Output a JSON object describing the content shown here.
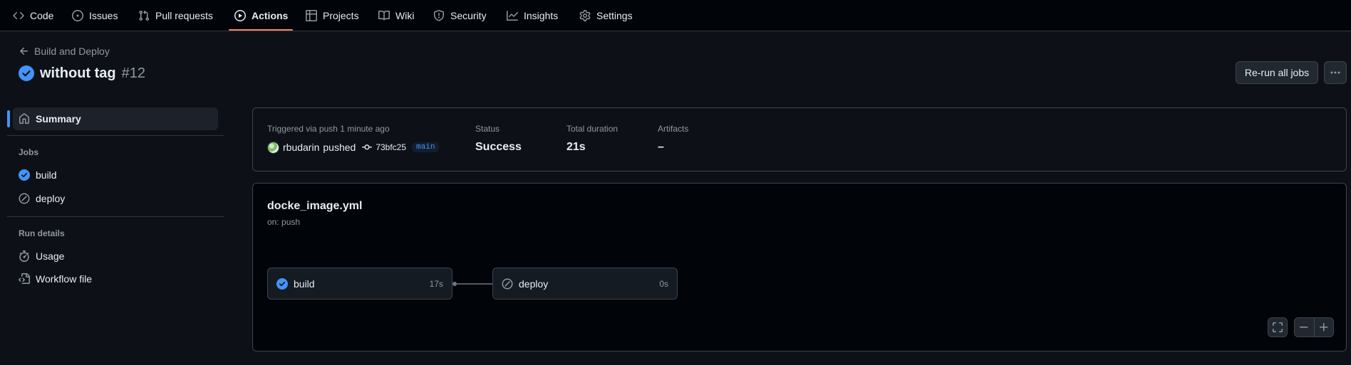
{
  "nav": {
    "items": [
      {
        "label": "Code",
        "icon": "code-icon"
      },
      {
        "label": "Issues",
        "icon": "issue-opened-icon"
      },
      {
        "label": "Pull requests",
        "icon": "git-pull-request-icon"
      },
      {
        "label": "Actions",
        "icon": "play-icon",
        "active": true
      },
      {
        "label": "Projects",
        "icon": "table-icon"
      },
      {
        "label": "Wiki",
        "icon": "book-icon"
      },
      {
        "label": "Security",
        "icon": "shield-icon"
      },
      {
        "label": "Insights",
        "icon": "graph-icon"
      },
      {
        "label": "Settings",
        "icon": "gear-icon"
      }
    ]
  },
  "header": {
    "back_label": "Build and Deploy",
    "title": "without tag",
    "run_number": "#12",
    "rerun_label": "Re-run all jobs",
    "more_label": "···"
  },
  "sidebar": {
    "summary_label": "Summary",
    "jobs_heading": "Jobs",
    "jobs": [
      {
        "label": "build",
        "status": "success"
      },
      {
        "label": "deploy",
        "status": "skipped"
      }
    ],
    "run_details_heading": "Run details",
    "run_details": [
      {
        "label": "Usage",
        "icon": "stopwatch-icon"
      },
      {
        "label": "Workflow file",
        "icon": "file-code-icon"
      }
    ]
  },
  "summary": {
    "trigger_label": "Triggered via push 1 minute ago",
    "actor": "rbudarin",
    "action": "pushed",
    "commit_sha": "73bfc25",
    "branch": "main",
    "status_label": "Status",
    "status_value": "Success",
    "duration_label": "Total duration",
    "duration_value": "21s",
    "artifacts_label": "Artifacts",
    "artifacts_value": "–"
  },
  "workflow": {
    "file_name": "docke_image.yml",
    "trigger": "on: push",
    "jobs": [
      {
        "name": "build",
        "duration": "17s",
        "status": "success"
      },
      {
        "name": "deploy",
        "duration": "0s",
        "status": "skipped"
      }
    ]
  },
  "colors": {
    "accent_blue": "#4493f8",
    "nav_underline": "#f78166",
    "success_check": "#4493f8"
  }
}
